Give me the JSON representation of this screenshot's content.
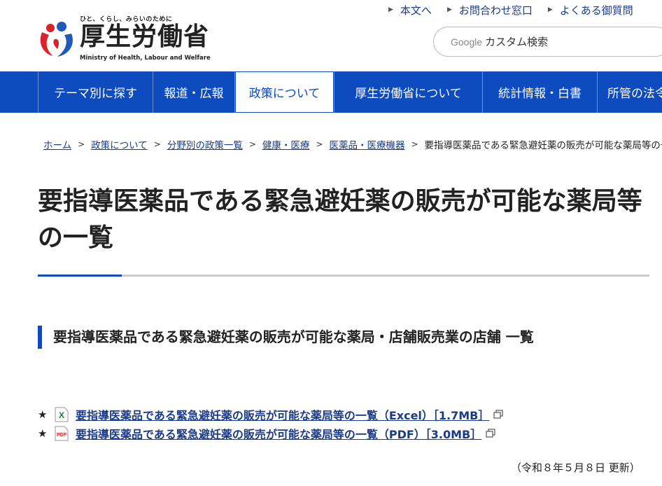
{
  "header": {
    "tagline": "ひと、くらし、みらいのために",
    "ministry_name": "厚生労働省",
    "ministry_name_en": "Ministry of Health, Labour and Welfare",
    "util_links": [
      {
        "label": "本文へ"
      },
      {
        "label": "お問合わせ窓口"
      },
      {
        "label": "よくある御質問"
      }
    ],
    "search": {
      "brand": "Google",
      "placeholder": "カスタム検索"
    }
  },
  "nav": {
    "items": [
      {
        "label": "テーマ別に探す"
      },
      {
        "label": "報道・広報"
      },
      {
        "label": "政策について"
      },
      {
        "label": "厚生労働省について"
      },
      {
        "label": "統計情報・白書"
      },
      {
        "label": "所管の法令"
      }
    ],
    "active_index": 2
  },
  "breadcrumb": {
    "items": [
      {
        "label": "ホーム"
      },
      {
        "label": "政策について"
      },
      {
        "label": "分野別の政策一覧"
      },
      {
        "label": "健康・医療"
      },
      {
        "label": "医薬品・医療機器"
      }
    ],
    "current": "要指導医薬品である緊急避妊薬の販売が可能な薬局等の一覧",
    "separator": ">"
  },
  "page": {
    "title": "要指導医薬品である緊急避妊薬の販売が可能な薬局等の一覧",
    "section_heading": "要指導医薬品である緊急避妊薬の販売が可能な薬局・店舗販売業の店舗 一覧",
    "documents": [
      {
        "bullet": "★",
        "icon": "excel-icon",
        "icon_text": "X",
        "label": "要指導医薬品である緊急避妊薬の販売が可能な薬局等の一覧（Excel）［1.7MB］"
      },
      {
        "bullet": "★",
        "icon": "pdf-icon",
        "icon_text": "PDF",
        "label": "要指導医薬品である緊急避妊薬の販売が可能な薬局等の一覧（PDF）［3.0MB］"
      }
    ],
    "updated": "（令和８年５月８日 更新）"
  },
  "colors": {
    "brand_blue": "#0d4bbf",
    "link": "#1a3a8a",
    "logo_red": "#d8232a",
    "logo_blue": "#1e5bb8"
  }
}
